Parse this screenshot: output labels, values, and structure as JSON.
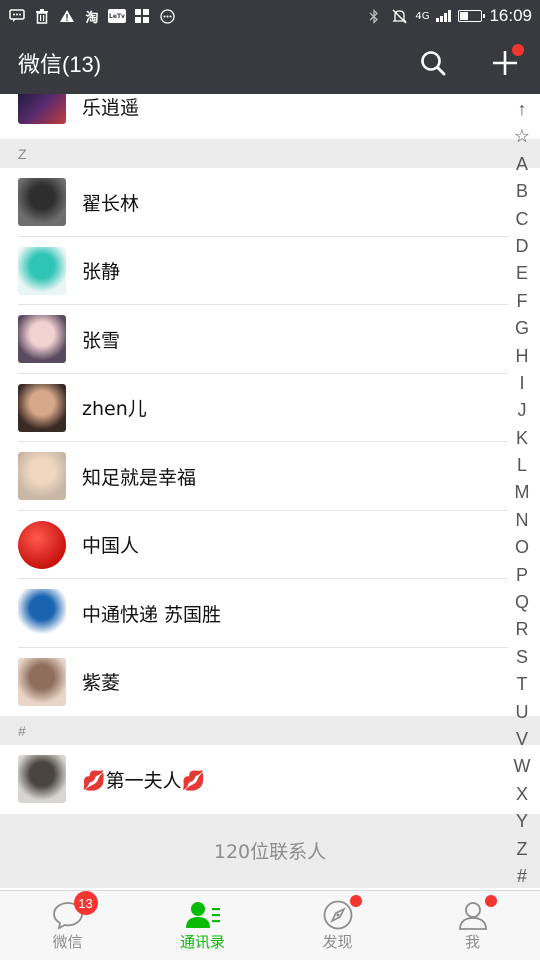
{
  "status_bar": {
    "time": "16:09",
    "network": "4G",
    "left_icons": [
      "message-icon",
      "trash-icon",
      "warning-icon",
      "taobao-icon",
      "letv-icon",
      "grid-app-icon",
      "more-dots-icon"
    ],
    "right_icons": [
      "bluetooth-icon",
      "mute-icon",
      "signal-icon",
      "battery-icon"
    ],
    "battery_fill": 0.35,
    "app_glyphs": {
      "taobao": "淘",
      "letv": "LeTv"
    }
  },
  "app_bar": {
    "title": "微信(13)",
    "search_icon": "search-icon",
    "add_icon": "plus-icon",
    "add_has_dot": true
  },
  "contacts": {
    "first_row_name": "乐逍遥",
    "sections": [
      {
        "letter": "Z",
        "items": [
          {
            "name": "翟长林",
            "avatar": {
              "bg": "#6e6e6e",
              "fg": "#2e2e2e"
            }
          },
          {
            "name": "张静",
            "avatar": {
              "bg": "#eaf6f4",
              "fg": "#2ec4b6"
            }
          },
          {
            "name": "张雪",
            "avatar": {
              "bg": "#5a4a60",
              "fg": "#f3d2d2"
            }
          },
          {
            "name": "zhen儿",
            "avatar": {
              "bg": "#3a2a24",
              "fg": "#d7a98a"
            }
          },
          {
            "name": "知足就是幸福",
            "avatar": {
              "bg": "#c9b7a5",
              "fg": "#f0d8c0"
            }
          },
          {
            "name": "中国人",
            "avatar": {
              "bg": "#ffffff",
              "fg": "#d8231f"
            }
          },
          {
            "name": "中通快递 苏国胜",
            "avatar": {
              "bg": "#ffffff",
              "fg": "#1a63b0"
            }
          },
          {
            "name": "紫菱",
            "avatar": {
              "bg": "#e9d6c8",
              "fg": "#8f6f5c"
            }
          }
        ]
      },
      {
        "letter": "#",
        "items": [
          {
            "name": "💋第一夫人💋",
            "avatar": {
              "bg": "#d9d6d2",
              "fg": "#4a4440"
            }
          }
        ]
      }
    ],
    "total_label": "120位联系人"
  },
  "index_bar": [
    "↑",
    "☆",
    "A",
    "B",
    "C",
    "D",
    "E",
    "F",
    "G",
    "H",
    "I",
    "J",
    "K",
    "L",
    "M",
    "N",
    "O",
    "P",
    "Q",
    "R",
    "S",
    "T",
    "U",
    "V",
    "W",
    "X",
    "Y",
    "Z",
    "#"
  ],
  "tabs": [
    {
      "label": "微信",
      "icon": "chat-bubble-icon",
      "badge": "13",
      "active": false
    },
    {
      "label": "通讯录",
      "icon": "contacts-icon",
      "active": true
    },
    {
      "label": "发现",
      "icon": "compass-icon",
      "dot": true,
      "active": false
    },
    {
      "label": "我",
      "icon": "person-icon",
      "dot": true,
      "active": false
    }
  ],
  "colors": {
    "header_bg": "#393a3f",
    "accent_green": "#09bb07",
    "badge_red": "#f43530",
    "section_bg": "#ececec"
  }
}
